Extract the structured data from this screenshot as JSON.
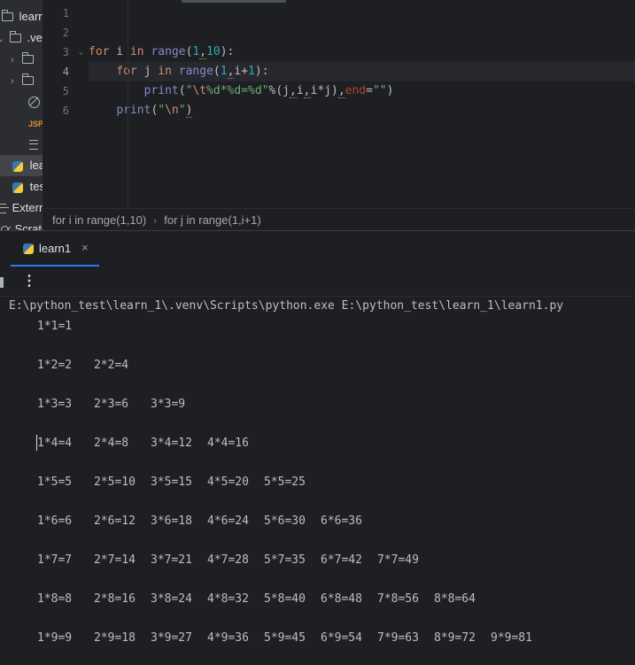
{
  "sidebar": {
    "project_name": "learn_",
    "venv_label": ".ven",
    "file_learn": "lear",
    "file_test": "tes",
    "external_libs": "Exterr",
    "scratches": "Scratc"
  },
  "editor": {
    "line_numbers": [
      "1",
      "2",
      "3",
      "4",
      "5",
      "6"
    ],
    "code": {
      "l3_kw_for": "for",
      "l3_var": " i ",
      "l3_kw_in": "in",
      "l3_fn": " range",
      "l3_open": "(",
      "l3_n1": "1",
      "l3_comma": ",",
      "l3_n2": "10",
      "l3_close": "):",
      "l4_indent": "    ",
      "l4_kw_for": "for",
      "l4_var": " j ",
      "l4_kw_in": "in",
      "l4_fn": " range",
      "l4_open": "(",
      "l4_n1": "1",
      "l4_comma": ",",
      "l4_expr": "i+",
      "l4_n2": "1",
      "l4_close": "):",
      "l5_indent": "        ",
      "l5_fn": "print",
      "l5_open": "(",
      "l5_q1": "\"",
      "l5_esc": "\\t",
      "l5_fmt": "%d*%d=%d\"",
      "l5_pct": "%(j",
      "l5_c1": ",",
      "l5_i": "i",
      "l5_c2": ",",
      "l5_prod": "i*j)",
      "l5_c3": ",",
      "l5_kwarg": "end",
      "l5_eq": "=",
      "l5_empty": "\"\"",
      "l5_close": ")",
      "l6_indent": "    ",
      "l6_fn": "print",
      "l6_open": "(",
      "l6_q1": "\"",
      "l6_esc": "\\n",
      "l6_q2": "\"",
      "l6_close": ")"
    }
  },
  "breadcrumb": {
    "item1": "for i in range(1,10)",
    "separator": "›",
    "item2": "for j in range(1,i+1)"
  },
  "run": {
    "tab_label": "learn1",
    "close_glyph": "×",
    "more_glyph": "⋮",
    "command": "E:\\python_test\\learn_1\\.venv\\Scripts\\python.exe E:\\python_test\\learn_1\\learn1.py",
    "output": [
      [
        "1*1=1"
      ],
      [
        "1*2=2",
        "2*2=4"
      ],
      [
        "1*3=3",
        "2*3=6",
        "3*3=9"
      ],
      [
        "1*4=4",
        "2*4=8",
        "3*4=12",
        "4*4=16"
      ],
      [
        "1*5=5",
        "2*5=10",
        "3*5=15",
        "4*5=20",
        "5*5=25"
      ],
      [
        "1*6=6",
        "2*6=12",
        "3*6=18",
        "4*6=24",
        "5*6=30",
        "6*6=36"
      ],
      [
        "1*7=7",
        "2*7=14",
        "3*7=21",
        "4*7=28",
        "5*7=35",
        "6*7=42",
        "7*7=49"
      ],
      [
        "1*8=8",
        "2*8=16",
        "3*8=24",
        "4*8=32",
        "5*8=40",
        "6*8=48",
        "7*8=56",
        "8*8=64"
      ],
      [
        "1*9=9",
        "2*9=18",
        "3*9=27",
        "4*9=36",
        "5*9=45",
        "6*9=54",
        "7*9=63",
        "8*9=72",
        "9*9=81"
      ]
    ]
  },
  "icons": {
    "folder": "folder-icon",
    "python": "python-file-icon",
    "excluded": "excluded-icon",
    "jsp": "jsp-file-icon",
    "text": "text-file-icon",
    "libraries": "library-icon"
  },
  "colors": {
    "keyword": "#cf8e6d",
    "builtin": "#8888c6",
    "number": "#2aacb8",
    "string": "#6aab73",
    "accent": "#3574f0"
  }
}
